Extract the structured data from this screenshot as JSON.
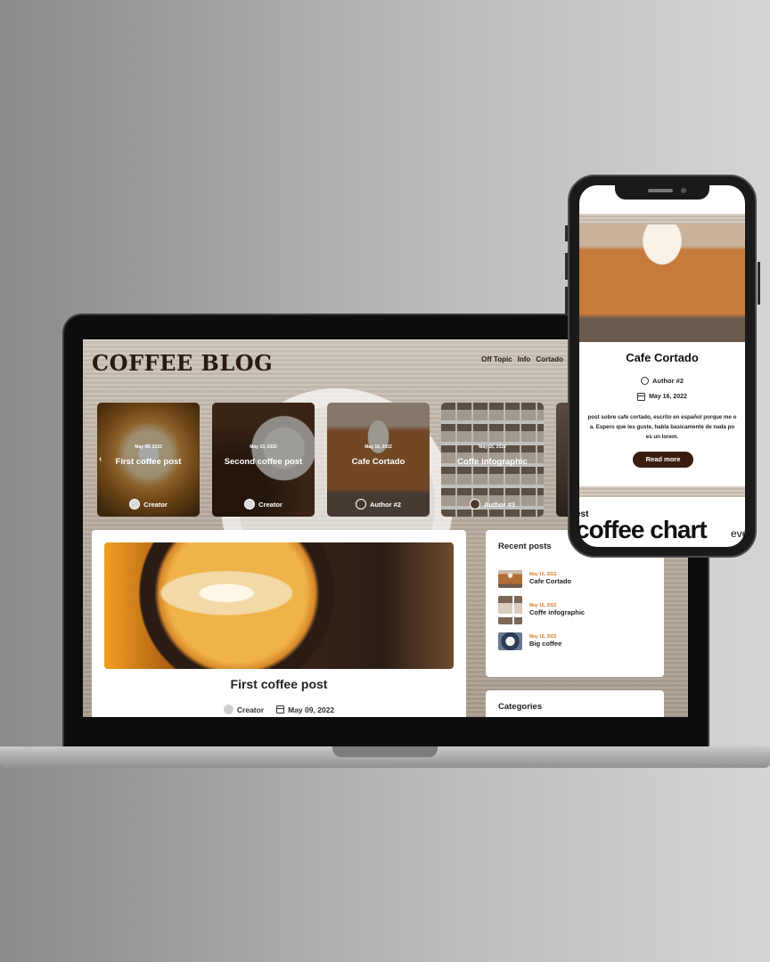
{
  "site": {
    "logo": "COFFEE BLOG",
    "nav": [
      "Off Topic",
      "Info",
      "Cortado"
    ]
  },
  "slider": {
    "slides": [
      {
        "date": "May 09, 2022",
        "title": "First coffee post",
        "author": "Creator"
      },
      {
        "date": "May 10, 2022",
        "title": "Second coffee post",
        "author": "Creator"
      },
      {
        "date": "May 16, 2022",
        "title": "Cafe Cortado",
        "author": "Author #2"
      },
      {
        "date": "May 16, 2022",
        "title": "Coffe infographic",
        "author": "Author #3"
      }
    ],
    "prev_icon": "‹"
  },
  "post": {
    "title": "First coffee post",
    "author": "Creator",
    "date": "May 09, 2022"
  },
  "sidebar": {
    "recent_title": "Recent posts",
    "recent": [
      {
        "date": "May 16, 2022",
        "title": "Cafe Cortado"
      },
      {
        "date": "May 16, 2022",
        "title": "Coffe infographic"
      },
      {
        "date": "May 16, 2022",
        "title": "Big coffee"
      }
    ],
    "categories_title": "Categories"
  },
  "phone": {
    "title": "Cafe Cortado",
    "author": "Author #2",
    "date": "May 16, 2022",
    "excerpt_lines": [
      "post sobre cafe cortado, escrito en español porque me o",
      "a. Espero que les guste, habla basicamente de nada po",
      "es un lorem."
    ],
    "read_more": "Read more",
    "chart_small": "est",
    "chart_big": "coffee chart",
    "chart_tail": "eve"
  },
  "colors": {
    "accent_date": "#d67b2b",
    "button_bg": "#3b1d10"
  }
}
